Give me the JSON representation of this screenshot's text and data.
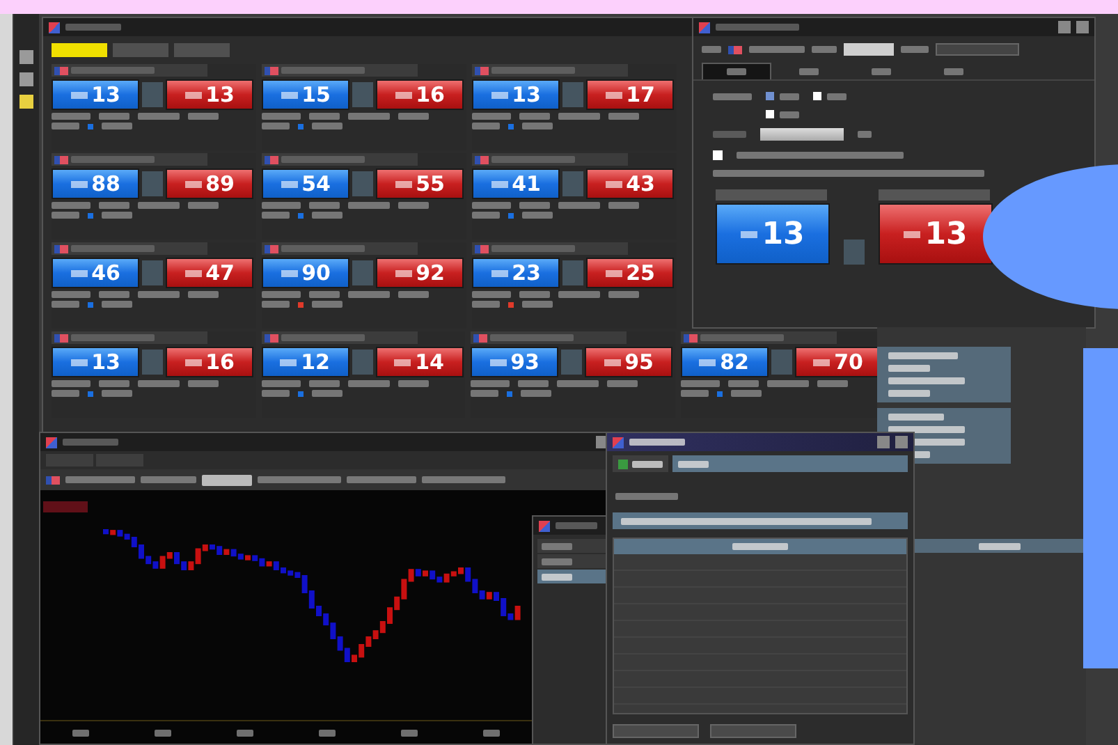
{
  "rate_panel": {
    "tabs": [
      {
        "selected": true
      },
      {
        "selected": false
      },
      {
        "selected": false
      }
    ],
    "rows": [
      [
        {
          "bid": "13",
          "ask": "13",
          "color": "#1a6fe0"
        },
        {
          "bid": "15",
          "ask": "16",
          "color": "#1a6fe0"
        },
        {
          "bid": "13",
          "ask": "17",
          "color": "#1a6fe0"
        }
      ],
      [
        {
          "bid": "88",
          "ask": "89",
          "color": "#1a6fe0"
        },
        {
          "bid": "54",
          "ask": "55",
          "color": "#1a6fe0"
        },
        {
          "bid": "41",
          "ask": "43",
          "color": "#1a6fe0"
        }
      ],
      [
        {
          "bid": "46",
          "ask": "47",
          "color": "#1a6fe0"
        },
        {
          "bid": "90",
          "ask": "92",
          "color": "#e03a2a"
        },
        {
          "bid": "23",
          "ask": "25",
          "color": "#e03a2a"
        }
      ],
      [
        {
          "bid": "13",
          "ask": "16",
          "color": "#1a6fe0"
        },
        {
          "bid": "12",
          "ask": "14",
          "color": "#1a6fe0"
        },
        {
          "bid": "93",
          "ask": "95",
          "color": "#1a6fe0"
        },
        {
          "bid": "82",
          "ask": "70",
          "color": "#1a6fe0"
        }
      ]
    ]
  },
  "order_window": {
    "tabs": [
      {
        "selected": true
      },
      {
        "selected": false
      },
      {
        "selected": false
      },
      {
        "selected": false
      }
    ],
    "options": [
      {
        "selected": true
      },
      {
        "selected": false
      },
      {
        "selected": false
      }
    ],
    "checkbox": {
      "checked": false
    },
    "bid": "13",
    "ask": "13"
  },
  "list_window": {
    "items": [
      {
        "selected": false
      },
      {
        "selected": false
      },
      {
        "selected": true
      }
    ]
  },
  "dialog": {
    "tabs": [
      {
        "selected": false
      },
      {
        "selected": true
      }
    ]
  }
}
